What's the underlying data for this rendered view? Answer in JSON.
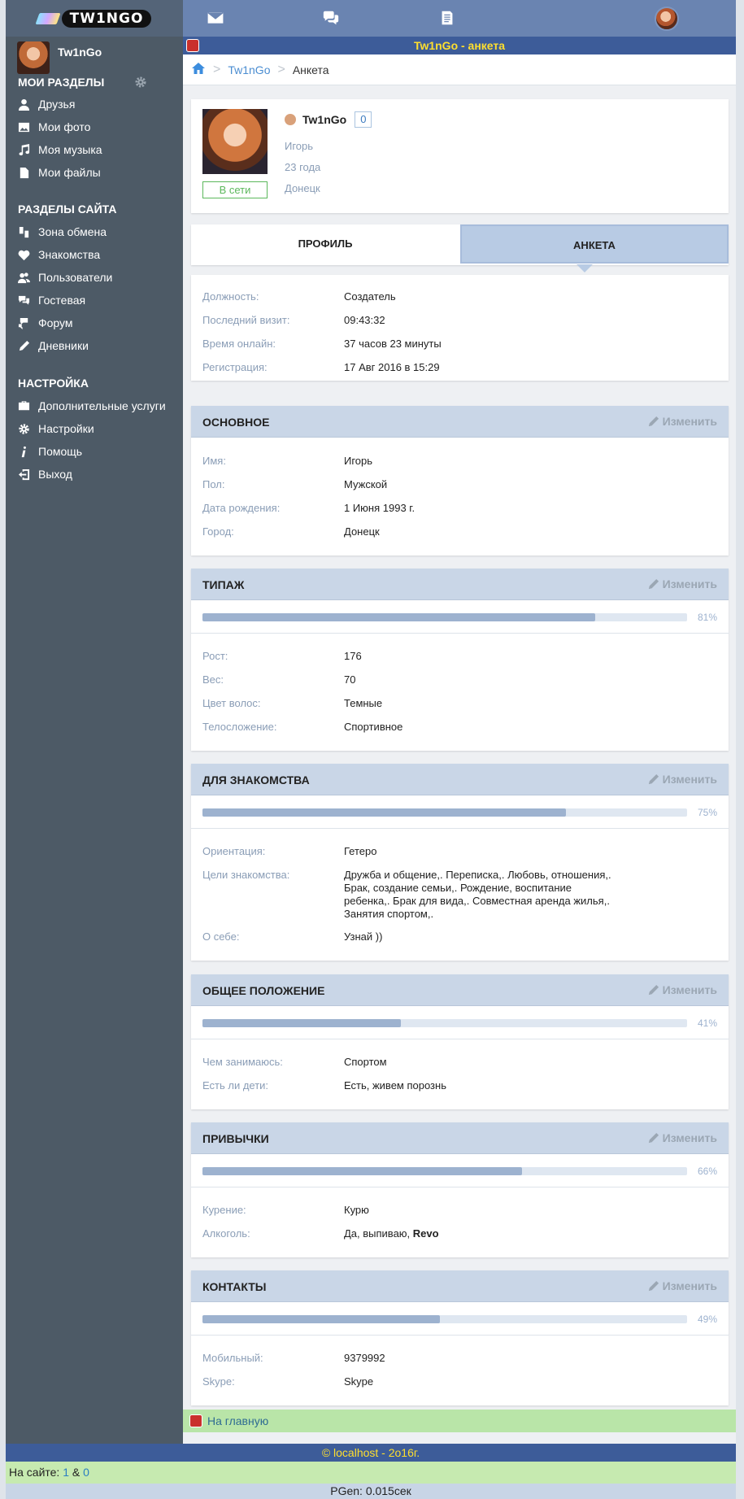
{
  "app": {
    "logo_text": "TW1NGO"
  },
  "user": {
    "name": "Tw1nGo"
  },
  "sidebar": {
    "my_sections_title": "МОИ РАЗДЕЛЫ",
    "my_items": [
      {
        "label": "Друзья",
        "icon": "user-icon"
      },
      {
        "label": "Мои фото",
        "icon": "image-icon"
      },
      {
        "label": "Моя музыка",
        "icon": "music-icon"
      },
      {
        "label": "Мои файлы",
        "icon": "file-icon"
      }
    ],
    "site_sections_title": "РАЗДЕЛЫ САЙТА",
    "site_items": [
      {
        "label": "Зона обмена",
        "icon": "exchange-icon"
      },
      {
        "label": "Знакомства",
        "icon": "heart-icon"
      },
      {
        "label": "Пользователи",
        "icon": "users-icon"
      },
      {
        "label": "Гостевая",
        "icon": "chat-icon"
      },
      {
        "label": "Форум",
        "icon": "forum-icon"
      },
      {
        "label": "Дневники",
        "icon": "pen-icon"
      }
    ],
    "settings_title": "НАСТРОЙКА",
    "settings_items": [
      {
        "label": "Дополнительные услуги",
        "icon": "briefcase-icon"
      },
      {
        "label": "Настройки",
        "icon": "gear-icon"
      },
      {
        "label": "Помощь",
        "icon": "info-icon"
      },
      {
        "label": "Выход",
        "icon": "logout-icon"
      }
    ]
  },
  "title_bar": "Tw1nGo - анкета",
  "breadcrumb": {
    "link": "Tw1nGo",
    "current": "Анкета"
  },
  "profile": {
    "name": "Tw1nGo",
    "count": "0",
    "real_name": "Игорь",
    "age": "23 года",
    "city": "Донецк",
    "status": "В сети"
  },
  "tabs": {
    "profile": "ПРОФИЛЬ",
    "questionnaire": "АНКЕТА"
  },
  "info": [
    {
      "k": "Должность:",
      "v": "Создатель"
    },
    {
      "k": "Последний визит:",
      "v": "09:43:32"
    },
    {
      "k": "Время онлайн:",
      "v": "37 часов 23 минуты"
    },
    {
      "k": "Регистрация:",
      "v": "17 Авг 2016 в 15:29"
    }
  ],
  "edit_label": "Изменить",
  "sections": {
    "basic": {
      "title": "ОСНОВНОЕ",
      "rows": [
        {
          "k": "Имя:",
          "v": "Игорь"
        },
        {
          "k": "Пол:",
          "v": "Мужской"
        },
        {
          "k": "Дата рождения:",
          "v": "1 Июня 1993 г."
        },
        {
          "k": "Город:",
          "v": "Донецк"
        }
      ]
    },
    "type": {
      "title": "ТИПАЖ",
      "progress": 81,
      "pct": "81%",
      "rows": [
        {
          "k": "Рост:",
          "v": "176"
        },
        {
          "k": "Вес:",
          "v": "70"
        },
        {
          "k": "Цвет волос:",
          "v": "Темные"
        },
        {
          "k": "Телосложение:",
          "v": "Спортивное"
        }
      ]
    },
    "dating": {
      "title": "ДЛЯ ЗНАКОМСТВА",
      "progress": 75,
      "pct": "75%",
      "rows": [
        {
          "k": "Ориентация:",
          "v": "Гетеро"
        },
        {
          "k": "Цели знакомства:",
          "v": "Дружба и общение,. Переписка,. Любовь, отношения,. Брак, создание семьи,. Рождение, воспитание ребенка,. Брак для вида,. Совместная аренда жилья,. Занятия спортом,."
        },
        {
          "k": "О себе:",
          "v": "Узнай ))"
        }
      ]
    },
    "general": {
      "title": "ОБЩЕЕ ПОЛОЖЕНИЕ",
      "progress": 41,
      "pct": "41%",
      "rows": [
        {
          "k": "Чем занимаюсь:",
          "v": "Спортом"
        },
        {
          "k": "Есть ли дети:",
          "v": "Есть, живем порознь"
        }
      ]
    },
    "habits": {
      "title": "ПРИВЫЧКИ",
      "progress": 66,
      "pct": "66%",
      "rows": [
        {
          "k": "Курение:",
          "v": "Курю"
        },
        {
          "k": "Алкоголь:",
          "v": "Да, выпиваю,",
          "v_bold": "Revo"
        }
      ]
    },
    "contacts": {
      "title": "КОНТАКТЫ",
      "progress": 49,
      "pct": "49%",
      "rows": [
        {
          "k": "Мобильный:",
          "v": "9379992"
        },
        {
          "k": "Skype:",
          "v": "Skype"
        }
      ]
    }
  },
  "footer": {
    "home_link": "На главную",
    "copyright": "© localhost - 2o16г.",
    "online_label": "На сайте:",
    "online_a": "1",
    "online_sep": "&",
    "online_b": "0",
    "pgen": "PGen: 0.015сек"
  },
  "colors": {
    "header": "#6a84b1",
    "sidebar": "#4d5a66",
    "section_head": "#c9d6e7",
    "title_text": "#ffdf2e",
    "online_green": "#5cb85c"
  }
}
